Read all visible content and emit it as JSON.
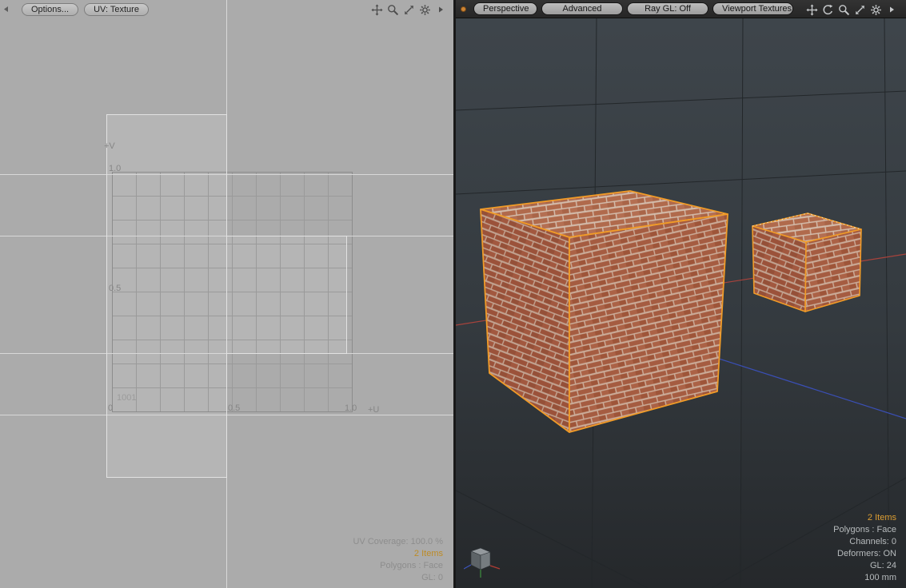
{
  "uv_panel": {
    "toolbar": {
      "options_button": "Options...",
      "uv_texture_button": "UV: Texture",
      "icons": [
        "pan-icon",
        "zoom-icon",
        "maximize-icon",
        "gear-icon",
        "flyout-arrow-icon"
      ]
    },
    "labels": {
      "v_axis": "+V",
      "u_axis": "+U",
      "v_1": "1.0",
      "v_05": "0.5",
      "origin": "0",
      "u_05": "0.5",
      "u_1": "1.0",
      "udim_tile": "1001"
    },
    "status": [
      {
        "text": "UV Coverage: 100.0 %",
        "highlight": false
      },
      {
        "text": "2 Items",
        "highlight": true
      },
      {
        "text": "Polygons : Face",
        "highlight": false
      },
      {
        "text": "GL: 0",
        "highlight": false
      }
    ]
  },
  "viewport_panel": {
    "toolbar": {
      "buttons": [
        "Perspective",
        "Advanced",
        "Ray GL: Off",
        "Viewport Textures"
      ],
      "icons": [
        "pan-icon",
        "rotate-icon",
        "zoom-icon",
        "maximize-icon",
        "gear-icon",
        "flyout-arrow-icon"
      ]
    },
    "scene": {
      "objects": [
        "brick-cube-large",
        "brick-cube-small"
      ],
      "selection_color": "#f09b28",
      "axis_red": "#a8433c",
      "axis_blue": "#3a4fb5",
      "brick_color": "#a2583f",
      "mortar_color": "#c9ae9d"
    },
    "status": [
      {
        "text": "2 Items",
        "highlight": true
      },
      {
        "text": "Polygons : Face",
        "highlight": false
      },
      {
        "text": "Channels: 0",
        "highlight": false
      },
      {
        "text": "Deformers: ON",
        "highlight": false
      },
      {
        "text": "GL: 24",
        "highlight": false
      },
      {
        "text": "100 mm",
        "highlight": false
      }
    ]
  }
}
